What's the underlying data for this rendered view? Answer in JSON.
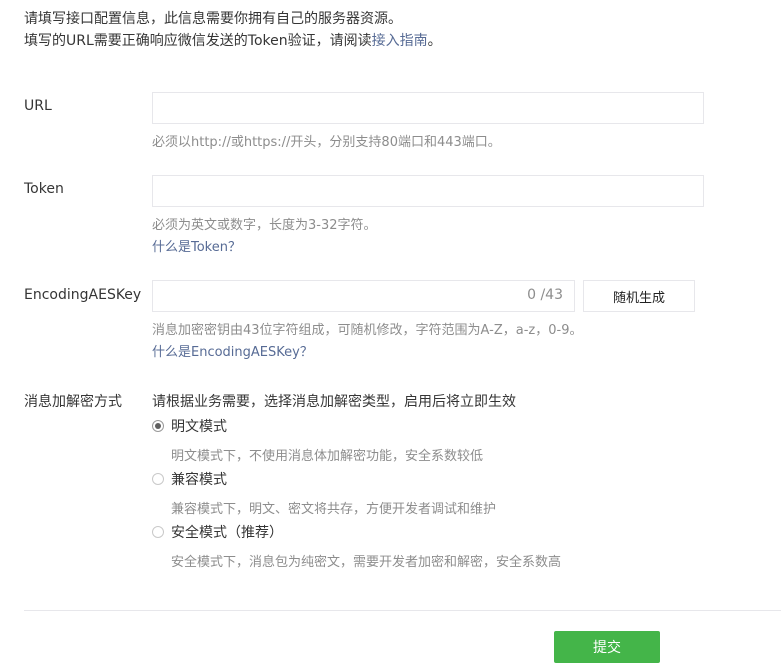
{
  "intro": {
    "line1": "请填写接口配置信息，此信息需要你拥有自己的服务器资源。",
    "line2_prefix": "填写的URL需要正确响应微信发送的Token验证，请阅读",
    "line2_link": "接入指南",
    "line2_suffix": "。"
  },
  "url_field": {
    "label": "URL",
    "value": "",
    "tip": "必须以http://或https://开头，分别支持80端口和443端口。"
  },
  "token_field": {
    "label": "Token",
    "value": "",
    "tip": "必须为英文或数字，长度为3-32字符。",
    "help_link": "什么是Token？"
  },
  "aes_field": {
    "label": "EncodingAESKey",
    "value": "",
    "counter": "0 /43",
    "generate_button": "随机生成",
    "tip": "消息加密密钥由43位字符组成，可随机修改，字符范围为A-Z，a-z，0-9。",
    "help_link": "什么是EncodingAESKey？"
  },
  "encryption": {
    "label": "消息加解密方式",
    "description": "请根据业务需要，选择消息加解密类型，启用后将立即生效",
    "selected": "plain",
    "options": [
      {
        "key": "plain",
        "label": "明文模式",
        "tip": "明文模式下，不使用消息体加解密功能，安全系数较低"
      },
      {
        "key": "compat",
        "label": "兼容模式",
        "tip": "兼容模式下，明文、密文将共存，方便开发者调试和维护"
      },
      {
        "key": "secure",
        "label": "安全模式（推荐）",
        "tip": "安全模式下，消息包为纯密文，需要开发者加密和解密，安全系数高"
      }
    ]
  },
  "submit_button": "提交",
  "colors": {
    "link": "#576b95",
    "tip": "#8d8d8d",
    "primary": "#44b549",
    "border": "#e7e7eb"
  }
}
